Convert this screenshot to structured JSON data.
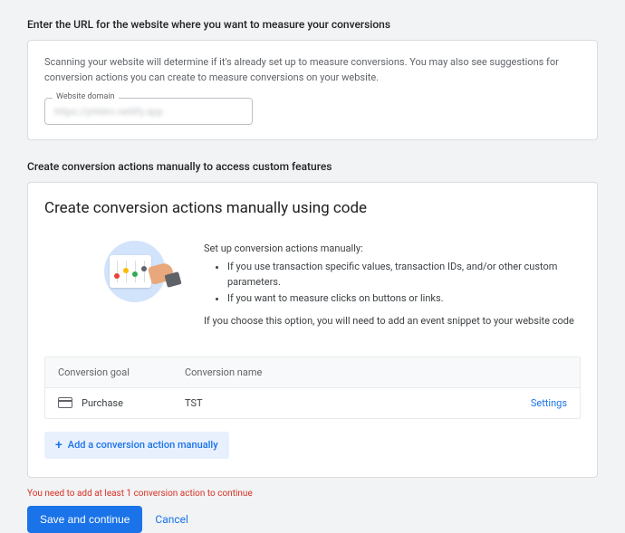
{
  "section1": {
    "title": "Enter the URL for the website where you want to measure your conversions",
    "desc": "Scanning your website will determine if it's already set up to measure conversions. You may also see suggestions for conversion actions you can create to measure conversions on your website.",
    "field_label": "Website domain",
    "field_value": "https://phldm.netlify.app"
  },
  "section2": {
    "title": "Create conversion actions manually to access custom features",
    "card_title": "Create conversion actions manually using code",
    "intro": "Set up conversion actions manually:",
    "bullets": [
      "If you use transaction specific values, transaction IDs, and/or other custom parameters.",
      "If you want to measure clicks on buttons or links."
    ],
    "outro": "If you choose this option, you will need to add an event snippet to your website code",
    "headers": {
      "goal": "Conversion goal",
      "name": "Conversion name"
    },
    "row": {
      "goal": "Purchase",
      "name": "TST",
      "action": "Settings"
    },
    "add_label": "Add a conversion action manually"
  },
  "footer": {
    "error": "You need to add at least 1 conversion action to continue",
    "save": "Save and continue",
    "cancel": "Cancel"
  }
}
